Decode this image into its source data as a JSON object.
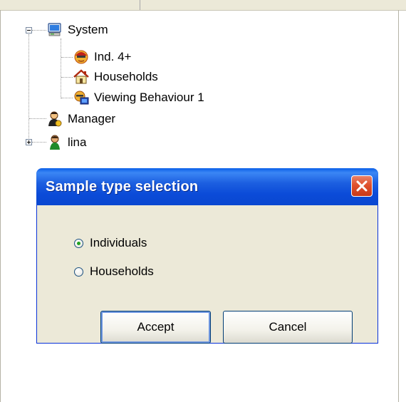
{
  "tree": {
    "root": {
      "label": "System",
      "icon": "computer-icon",
      "expanded": true
    },
    "children": [
      {
        "label": "Ind. 4+",
        "icon": "person-face-icon"
      },
      {
        "label": "Households",
        "icon": "house-icon"
      },
      {
        "label": "Viewing Behaviour 1",
        "icon": "viewer-tv-icon"
      }
    ],
    "siblings": [
      {
        "label": "Manager",
        "icon": "manager-user-icon"
      },
      {
        "label": "lina",
        "icon": "user-icon",
        "expanded": false
      }
    ]
  },
  "dialog": {
    "title": "Sample type selection",
    "close_icon": "close-icon",
    "options": [
      {
        "label": "Individuals",
        "checked": true
      },
      {
        "label": "Households",
        "checked": false
      }
    ],
    "accept_label": "Accept",
    "cancel_label": "Cancel"
  },
  "colors": {
    "titlebar": "#0b4bd8",
    "close_button": "#e0512d",
    "dialog_face": "#ece9d8"
  }
}
